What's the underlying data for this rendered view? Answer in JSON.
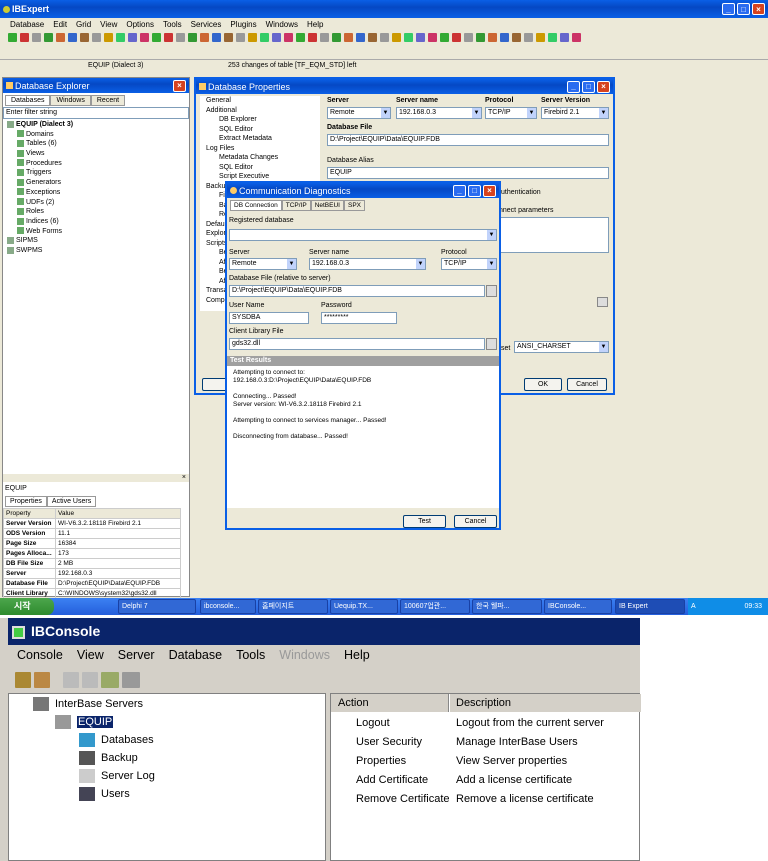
{
  "ibexpert": {
    "title": "IBExpert",
    "menu": [
      "Database",
      "Edit",
      "Grid",
      "View",
      "Options",
      "Tools",
      "Services",
      "Plugins",
      "Windows",
      "Help"
    ],
    "status1": "EQUIP (Dialect 3)",
    "status2": "253 changes of table [TF_EQM_STD] left"
  },
  "explorer": {
    "title": "Database Explorer",
    "tabs": [
      "Databases",
      "Windows",
      "Recent"
    ],
    "filter": "Enter filter string",
    "tree": [
      {
        "t": "EQUIP (Dialect 3)",
        "d": 0
      },
      {
        "t": "Domains",
        "d": 1
      },
      {
        "t": "Tables (6)",
        "d": 1
      },
      {
        "t": "Views",
        "d": 1
      },
      {
        "t": "Procedures",
        "d": 1
      },
      {
        "t": "Triggers",
        "d": 1
      },
      {
        "t": "Generators",
        "d": 1
      },
      {
        "t": "Exceptions",
        "d": 1
      },
      {
        "t": "UDFs (2)",
        "d": 1
      },
      {
        "t": "Roles",
        "d": 1
      },
      {
        "t": "Indices (6)",
        "d": 1
      },
      {
        "t": "Web Forms",
        "d": 1
      },
      {
        "t": "SIPMS",
        "d": 0
      },
      {
        "t": "SWPMS",
        "d": 0
      }
    ],
    "info_title": "EQUIP",
    "info_tabs": [
      "Properties",
      "Active Users"
    ],
    "info_head": [
      "Property",
      "Value"
    ],
    "info_rows": [
      [
        "Server Version",
        "WI-V6.3.2.18118 Firebird 2.1"
      ],
      [
        "ODS Version",
        "11.1"
      ],
      [
        "Page Size",
        "16384"
      ],
      [
        "Pages Alloca...",
        "173"
      ],
      [
        "DB File Size",
        "2 MB"
      ],
      [
        "Server",
        "192.168.0.3"
      ],
      [
        "Database File",
        "D:\\Project\\EQUIP\\Data\\EQUIP.FDB"
      ],
      [
        "Client Library",
        "C:\\WINDOWS\\system32\\gds32.dll"
      ]
    ]
  },
  "dbprops": {
    "title": "Database Properties",
    "nav": [
      {
        "t": "General",
        "d": 0
      },
      {
        "t": "Additional",
        "d": 0
      },
      {
        "t": "DB Explorer",
        "d": 1
      },
      {
        "t": "SQL Editor",
        "d": 1
      },
      {
        "t": "Extract Metadata",
        "d": 1
      },
      {
        "t": "Log Files",
        "d": 0
      },
      {
        "t": "Metadata Changes",
        "d": 1
      },
      {
        "t": "SQL Editor",
        "d": 1
      },
      {
        "t": "Script Executive",
        "d": 1
      },
      {
        "t": "Backup",
        "d": 0
      },
      {
        "t": "File",
        "d": 1
      },
      {
        "t": "Bac",
        "d": 1
      },
      {
        "t": "Res",
        "d": 1
      },
      {
        "t": "Default",
        "d": 0
      },
      {
        "t": "Explore",
        "d": 0
      },
      {
        "t": "Scripts",
        "d": 0
      },
      {
        "t": "Bef",
        "d": 1
      },
      {
        "t": "Aft",
        "d": 1
      },
      {
        "t": "Bef",
        "d": 1
      },
      {
        "t": "Aft",
        "d": 1
      },
      {
        "t": "Transa",
        "d": 0
      },
      {
        "t": "Compa",
        "d": 0
      }
    ],
    "server_label": "Server",
    "server": "Remote",
    "servername_label": "Server name",
    "servername": "192.168.0.3",
    "protocol_label": "Protocol",
    "protocol": "TCP/IP",
    "version_label": "Server Version",
    "version": "Firebird 2.1",
    "dbfile_label": "Database File",
    "dbfile": "D:\\Project\\EQUIP\\Data\\EQUIP.FDB",
    "alias_label": "Database Alias",
    "alias": "EQUIP",
    "auth": "uthentication",
    "connparams": "nnect parameters",
    "charset_label": "set",
    "charset": "ANSI_CHARSET",
    "ok": "OK",
    "cancel": "Cancel"
  },
  "diag": {
    "title": "Communication Diagnostics",
    "tabs": [
      "DB Connection",
      "TCP/IP",
      "NetBEUI",
      "SPX"
    ],
    "reg_label": "Registered database",
    "server_label": "Server",
    "server": "Remote",
    "servername_label": "Server name",
    "servername": "192.168.0.3",
    "protocol_label": "Protocol",
    "protocol": "TCP/IP",
    "dbfile_label": "Database File (relative to server)",
    "dbfile": "D:\\Project\\EQUIP\\Data\\EQUIP.FDB",
    "user_label": "User Name",
    "user": "SYSDBA",
    "pass_label": "Password",
    "pass": "*********",
    "lib_label": "Client Library File",
    "lib": "gds32.dll",
    "results_label": "Test Results",
    "results": [
      "Attempting to connect to:",
      "192.168.0.3:D:\\Project\\EQUIP\\Data\\EQUIP.FDB",
      "",
      "Connecting... Passed!",
      "Server version: WI-V6.3.2.18118 Firebird 2.1",
      "",
      "Attempting to connect to services manager... Passed!",
      "",
      "Disconnecting from database... Passed!"
    ],
    "test": "Test",
    "cancel": "Cancel"
  },
  "taskbar": {
    "start": "시작",
    "items": [
      "Delphi 7",
      "ibconsole...",
      "홈페이지트",
      "Uequip.TX...",
      "100607업관...",
      "한국 웰파...",
      "IBConsole...",
      "IB Expert"
    ],
    "lang": "A",
    "clock": "09:33"
  },
  "ibconsole": {
    "title": "IBConsole",
    "menu": [
      "Console",
      "View",
      "Server",
      "Database",
      "Tools",
      "Windows",
      "Help"
    ],
    "tree": [
      "InterBase Servers",
      "EQUIP",
      "Databases",
      "Backup",
      "Server Log",
      "Users"
    ],
    "head_action": "Action",
    "head_desc": "Description",
    "actions": [
      [
        "Logout",
        "Logout from the current server"
      ],
      [
        "User Security",
        "Manage InterBase Users"
      ],
      [
        "Properties",
        "View Server properties"
      ],
      [
        "Add Certificate",
        "Add a license certificate"
      ],
      [
        "Remove Certificate",
        "Remove a license certificate"
      ]
    ]
  }
}
